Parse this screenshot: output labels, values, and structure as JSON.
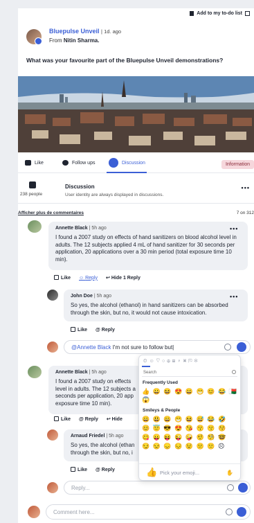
{
  "header": {
    "todo_label": "Add to my to-do list"
  },
  "post": {
    "author": "Bluepulse Unveil",
    "meta": "| 1d. ago",
    "from_prefix": "From",
    "from_name": "Nitin Sharma.",
    "question": "What was your favourite part of the Bluepulse Unveil demonstrations?"
  },
  "tabs": [
    {
      "label": "Like",
      "icon": "thumbs-up-icon"
    },
    {
      "label": "Follow ups",
      "icon": "chat-icon"
    },
    {
      "label": "Discussion",
      "icon": "discussion-icon",
      "active": true
    }
  ],
  "info_badge": "Information",
  "discussion": {
    "people": "238 people",
    "title": "Discussion",
    "subtitle": "User identity are always displayed in discussions."
  },
  "more_comments": "Afficher plus de commentaires",
  "comment_count": "7 on 312",
  "comments": [
    {
      "name": "Annette Black",
      "meta": "| 5h ago",
      "text": "I found a 2007 study on effects of hand sanitizers on blood alcohol level in adults. The 12 subjects applied 4 mL of hand sanitizer for 30 seconds per application, 20 applications over a 30 min period (total exposure time 10 min).",
      "like": "Like",
      "reply": "Reply",
      "hide": "Hide 1 Reply"
    },
    {
      "name": "John Doe",
      "meta": "| 5h ago",
      "text": "So yes, the alcohol (ethanol) in hand sanitizers can be absorbed through the skin, but no, it would not cause intoxication.",
      "like": "Like",
      "reply": "Reply"
    },
    {
      "name": "Annette Black",
      "meta": "| 5h ago",
      "text": "I found a 2007 study on effects of hand sanitizers on blood alcohol level in adults. The 12 subjects applied 4 mL of hand sanitizer for 30 seconds per application, 20 applications over a 30 min period (total exposure time 10 min).",
      "text_visible": "I found a 2007 study on effects\nlevel in adults. The 12 subjects a\nseconds per application, 20 app\nexposure time 10 min).",
      "like": "Like",
      "reply": "Reply",
      "hide": "Hide"
    },
    {
      "name": "Arnaud Friedel",
      "meta": "| 5h ago",
      "text_visible": "So yes, the alcohol (ethan\nthrough the skin, but no, i",
      "like": "Like",
      "reply": "Reply"
    }
  ],
  "reply_input": {
    "mention": "@Annette Black",
    "value": " I'm not sure to follow but|"
  },
  "reply_placeholder": "Reply...",
  "comment_placeholder": "Comment here...",
  "emoji_picker": {
    "search_placeholder": "Search",
    "frequently_used": "Frequently Used",
    "frequent_emojis": "👍 😀 😆 😍 😀 😁 😊 😂 🇲🇬",
    "frequent_emojis_2": "😱",
    "smileys_label": "Smileys & People",
    "smileys_row1": "😀 😃 😄 😁 😆 😅 😂 🤣",
    "smileys_row2": "😊 😇 😎 😍 😘 😗 😙 😚",
    "smileys_row3": "😋 😛 😝 😜 🤪 🤨 🧐 🤓",
    "smileys_row4": "😏 😒 😞 😔 😟 😕 🙁 ☹",
    "preview_emoji": "👍",
    "pick_label": "Pick your emoji...",
    "tone": "✋"
  },
  "colors": {
    "accent": "#3b5fd6",
    "badge_bg": "#f6d7dc"
  }
}
